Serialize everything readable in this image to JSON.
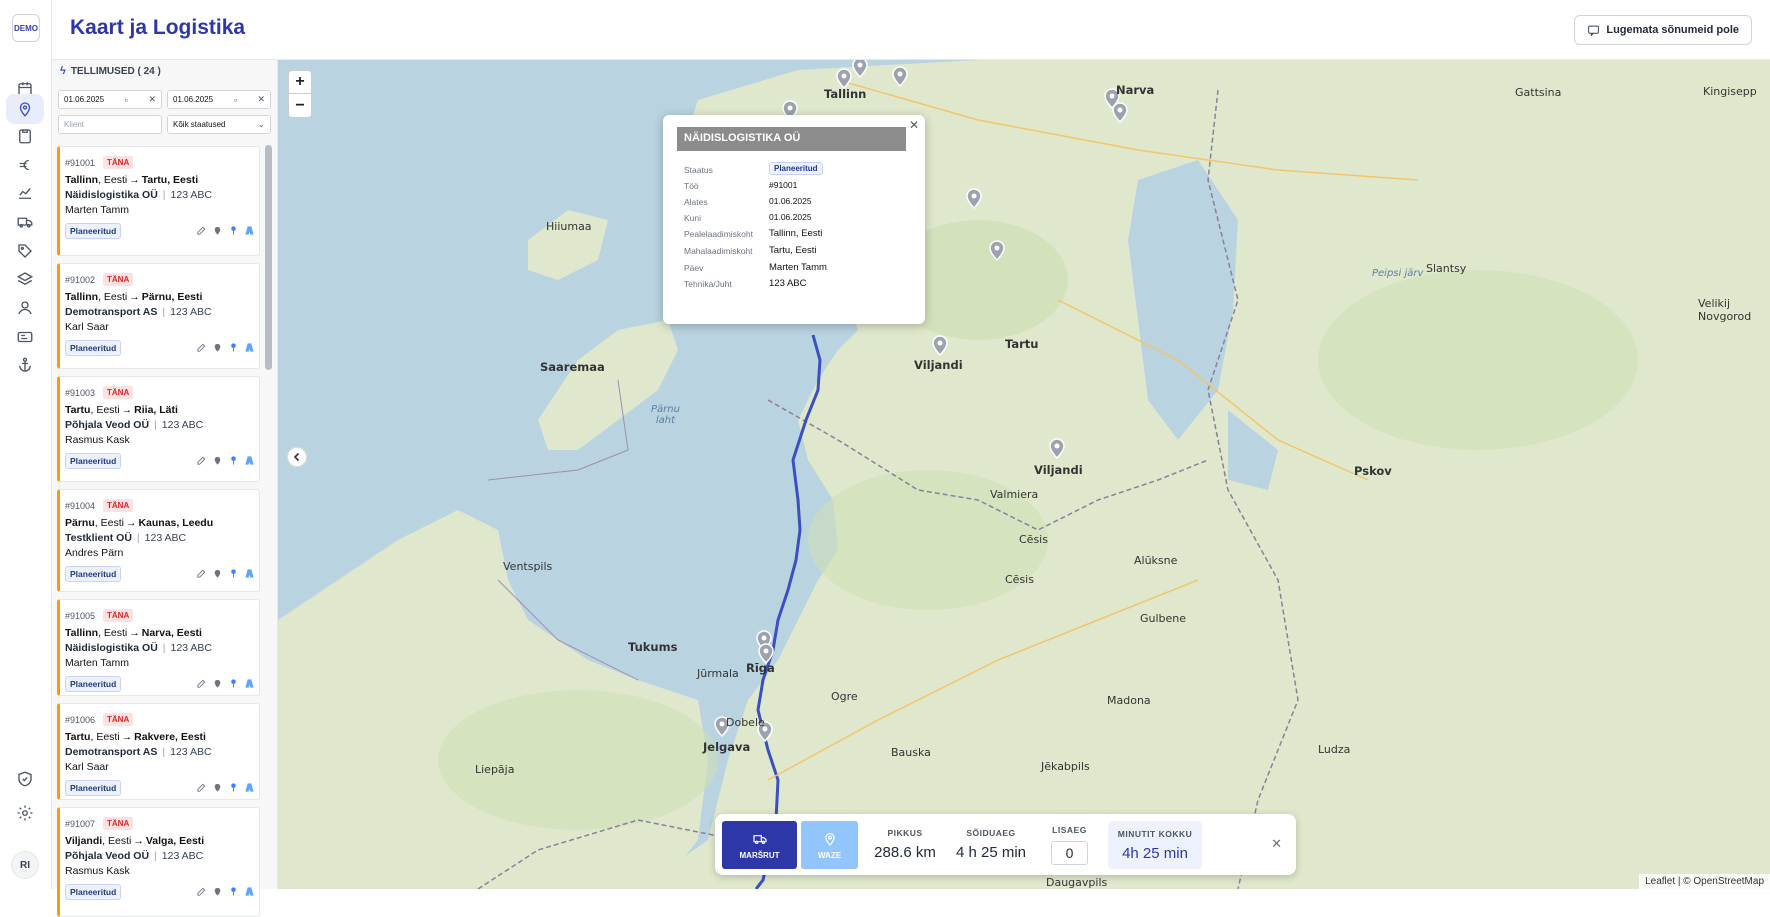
{
  "app": {
    "logo": "DEMO",
    "title": "Kaart ja Logistika",
    "unread_button": "Lugemata sõnumeid pole",
    "user_initials": "RI"
  },
  "rail": [
    "calendar-icon",
    "map-pin-icon",
    "clipboard-icon",
    "euro-icon",
    "chart-icon",
    "truck-icon",
    "tag-icon",
    "layers-icon",
    "user-icon",
    "id-card-icon",
    "anchor-icon",
    "shield-icon",
    "settings-icon"
  ],
  "sidebar": {
    "heading": "TELLIMUSED ( 24 )",
    "date_from": "01.06.2025",
    "date_to": "01.06.2025",
    "client_placeholder": "Klient",
    "status_select": "Kõik staatused"
  },
  "orders": [
    {
      "id": "#91001",
      "tag": "TÄNA",
      "from_city": "Tallinn",
      "from_country": "Eesti",
      "to": "Tartu, Eesti",
      "company": "Näidislogistika OÜ",
      "plate": "123 ABC",
      "driver": "Marten Tamm",
      "status": "Planeeritud"
    },
    {
      "id": "#91002",
      "tag": "TÄNA",
      "from_city": "Tallinn",
      "from_country": "Eesti",
      "to": "Pärnu, Eesti",
      "company": "Demotransport AS",
      "plate": "123 ABC",
      "driver": "Karl Saar",
      "status": "Planeeritud"
    },
    {
      "id": "#91003",
      "tag": "TÄNA",
      "from_city": "Tartu",
      "from_country": "Eesti",
      "to": "Riia, Läti",
      "company": "Põhjala Veod OÜ",
      "plate": "123 ABC",
      "driver": "Rasmus Kask",
      "status": "Planeeritud"
    },
    {
      "id": "#91004",
      "tag": "TÄNA",
      "from_city": "Pärnu",
      "from_country": "Eesti",
      "to": "Kaunas, Leedu",
      "company": "Testklient OÜ",
      "plate": "123 ABC",
      "driver": "Andres Pärn",
      "status": "Planeeritud"
    },
    {
      "id": "#91005",
      "tag": "TÄNA",
      "from_city": "Tallinn",
      "from_country": "Eesti",
      "to": "Narva, Eesti",
      "company": "Näidislogistika OÜ",
      "plate": "123 ABC",
      "driver": "Marten Tamm",
      "status": "Planeeritud"
    },
    {
      "id": "#91006",
      "tag": "TÄNA",
      "from_city": "Tartu",
      "from_country": "Eesti",
      "to": "Rakvere, Eesti",
      "company": "Demotransport AS",
      "plate": "123 ABC",
      "driver": "Karl Saar",
      "status": "Planeeritud"
    },
    {
      "id": "#91007",
      "tag": "TÄNA",
      "from_city": "Viljandi",
      "from_country": "Eesti",
      "to": "Valga, Eesti",
      "company": "Põhjala Veod OÜ",
      "plate": "123 ABC",
      "driver": "Rasmus Kask",
      "status": "Planeeritud"
    }
  ],
  "popup": {
    "title": "NÄIDISLOGISTIKA OÜ",
    "rows": [
      {
        "label": "Staatus",
        "value": "Planeeritud"
      },
      {
        "label": "Töö",
        "value": "#91001"
      },
      {
        "label": "Alates",
        "value": "01.06.2025"
      },
      {
        "label": "Kuni",
        "value": "01.06.2025"
      },
      {
        "label": "Pealelaadimiskoht",
        "value": "Tallinn, Eesti"
      },
      {
        "label": "Mahalaadimiskoht",
        "value": "Tartu, Eesti"
      },
      {
        "label": "Päev",
        "value": "Marten Tamm"
      },
      {
        "label": "Tehnika/Juht",
        "value": "123 ABC"
      }
    ]
  },
  "route_bar": {
    "route_label": "MARŠRUT",
    "waze_label": "WAZE",
    "length_label": "PIKKUS",
    "length_value": "288.6 km",
    "drive_label": "SÕIDUAEG",
    "drive_value": "4 h 25 min",
    "extra_label": "LISAEG",
    "extra_value": "0",
    "total_label": "MINUTIT KOKKU",
    "total_value": "4h 25 min"
  },
  "map": {
    "zoom_in": "+",
    "zoom_out": "−",
    "attribution": "Leaflet | © OpenStreetMap",
    "labels": {
      "tallinn": "Tallinn",
      "narva": "Narva",
      "tartu": "Tartu",
      "viljandi": "Viljandi",
      "viljandi2": "Viljandi",
      "parnu_laht": "Pärnu\nlaht",
      "saaremaa": "Saaremaa",
      "hiiumaa": "Hiiumaa",
      "riga": "Rīga",
      "jelgava": "Jelgava",
      "jurmala": "Jūrmala",
      "tukums": "Tukums",
      "ventspils": "Ventspils",
      "liepaja": "Liepāja",
      "valmiera": "Valmiera",
      "cesis": "Cēsis",
      "cesis2": "Cēsis",
      "aluksne": "Alūksne",
      "gulbene": "Gulbene",
      "madona": "Madona",
      "ogre": "Ogre",
      "bauska": "Bauska",
      "jekabpils": "Jēkabpils",
      "daugavpils": "Daugavpils",
      "pskov": "Pskov",
      "ludza": "Ludza",
      "velikij": "Velikij\nNovgorod",
      "peipsi": "Peipsi järv",
      "kingisepp": "Kingisepp",
      "slantsy": "Slantsy",
      "gattsina": "Gattsina",
      "dobele": "Dobele"
    }
  },
  "colors": {
    "brand": "#2e37a8",
    "accent_route": "#3b4fc4",
    "today": "#dc2626",
    "card_border": "#f59e0b",
    "water": "#b9d3e0",
    "land": "#dfe8cc"
  }
}
